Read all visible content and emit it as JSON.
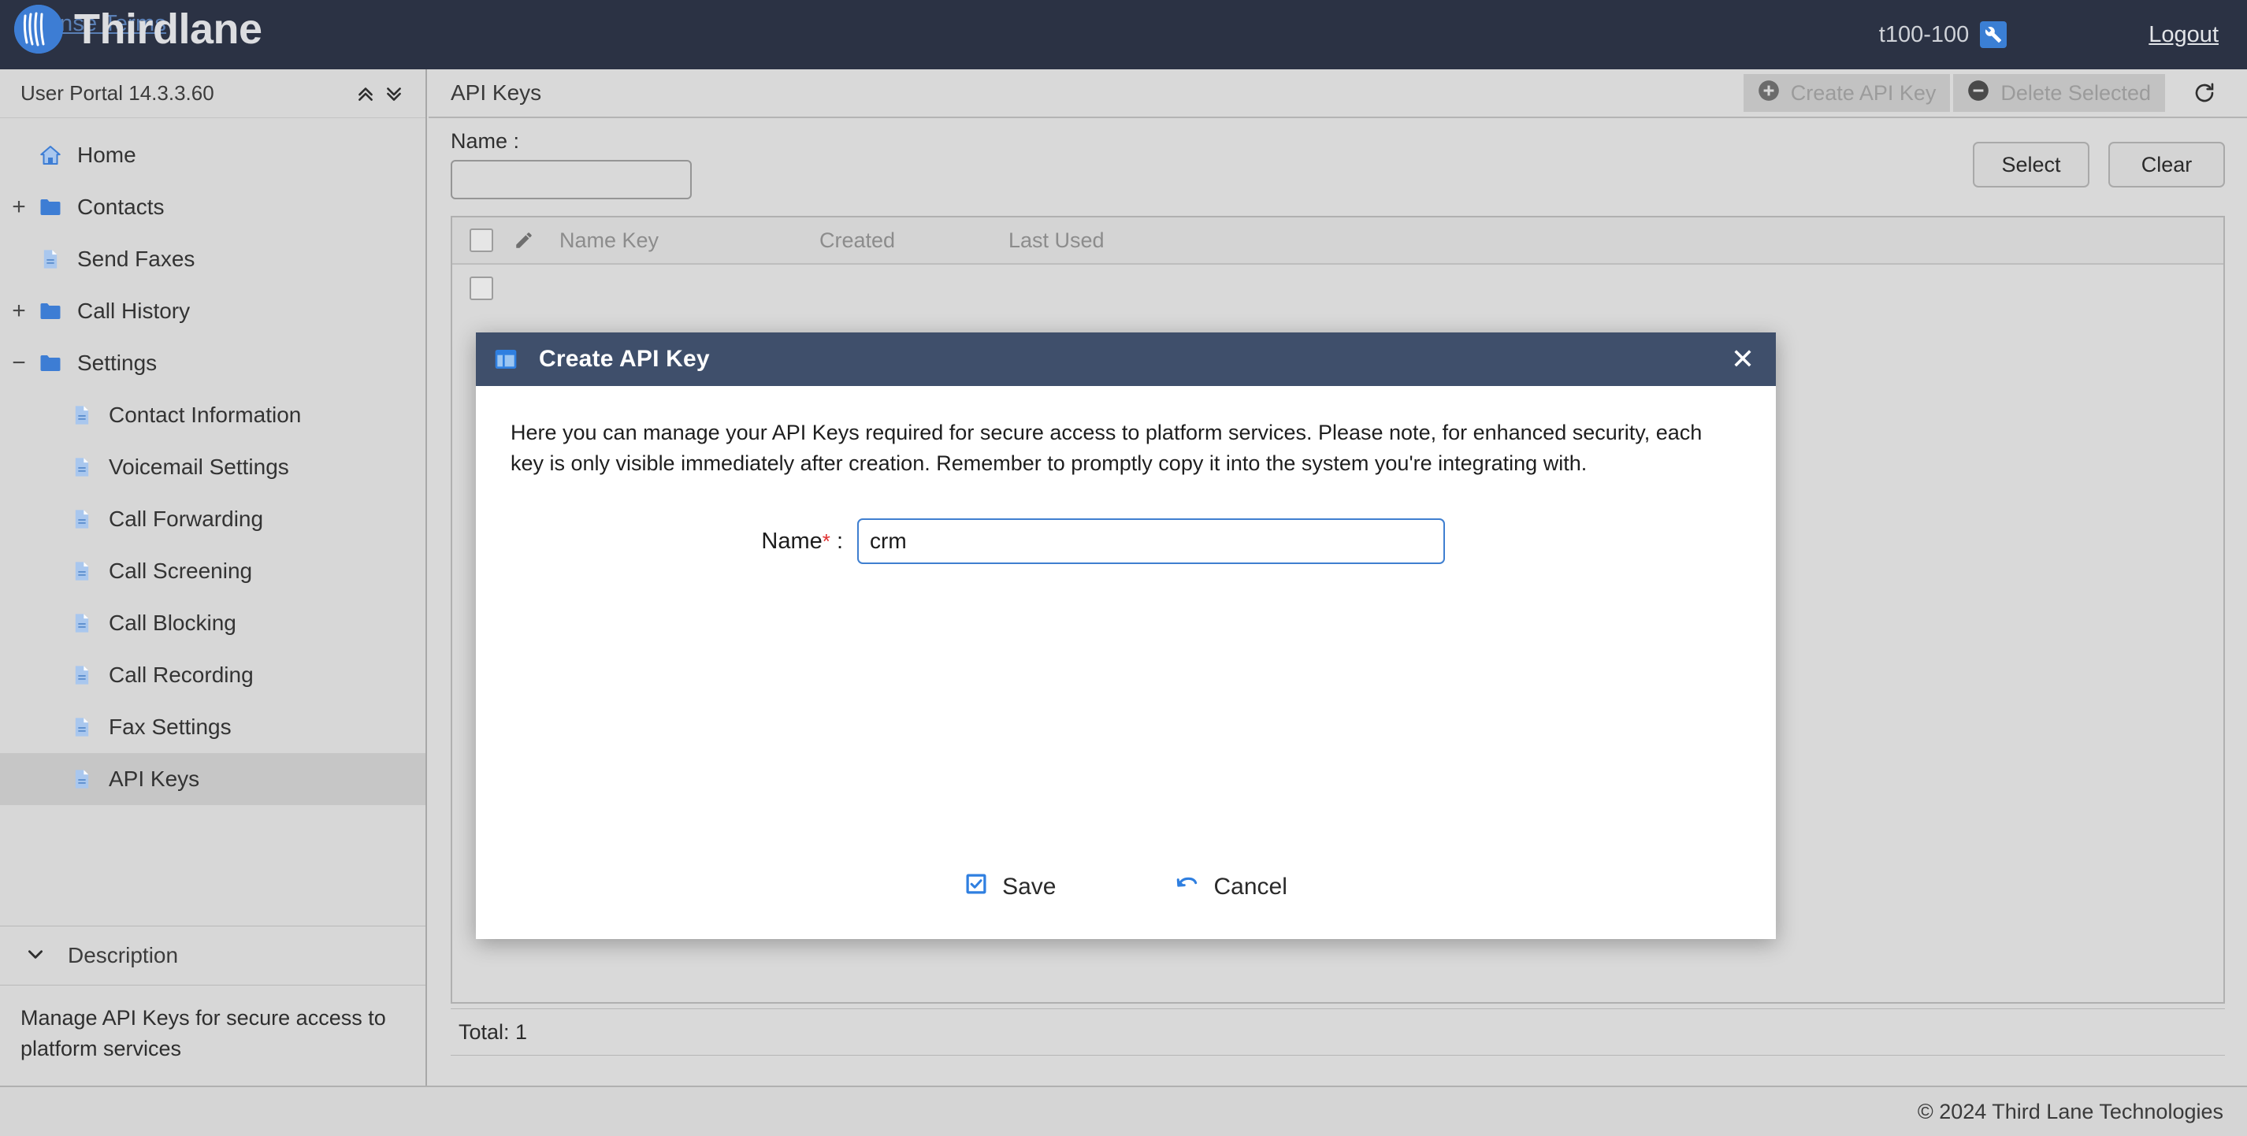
{
  "topbar": {
    "license_link": "License Terms",
    "brand_name": "Thirdlane",
    "account_name": "t100-100",
    "wrench_icon": "wrench-icon",
    "logout_label": "Logout"
  },
  "sidebar": {
    "title": "User Portal 14.3.3.60",
    "collapse_all_icon": "double-chevron-up-icon",
    "expand_all_icon": "double-chevron-down-icon",
    "items": [
      {
        "label": "Home",
        "icon": "home-icon",
        "expander": "",
        "level": 0,
        "selected": false
      },
      {
        "label": "Contacts",
        "icon": "folder-icon",
        "expander": "+",
        "level": 0,
        "selected": false
      },
      {
        "label": "Send Faxes",
        "icon": "document-icon",
        "expander": "",
        "level": 0,
        "selected": false
      },
      {
        "label": "Call History",
        "icon": "folder-icon",
        "expander": "+",
        "level": 0,
        "selected": false
      },
      {
        "label": "Settings",
        "icon": "folder-icon",
        "expander": "−",
        "level": 0,
        "selected": false
      },
      {
        "label": "Contact Information",
        "icon": "document-icon",
        "expander": "",
        "level": 1,
        "selected": false
      },
      {
        "label": "Voicemail Settings",
        "icon": "document-icon",
        "expander": "",
        "level": 1,
        "selected": false
      },
      {
        "label": "Call Forwarding",
        "icon": "document-icon",
        "expander": "",
        "level": 1,
        "selected": false
      },
      {
        "label": "Call Screening",
        "icon": "document-icon",
        "expander": "",
        "level": 1,
        "selected": false
      },
      {
        "label": "Call Blocking",
        "icon": "document-icon",
        "expander": "",
        "level": 1,
        "selected": false
      },
      {
        "label": "Call Recording",
        "icon": "document-icon",
        "expander": "",
        "level": 1,
        "selected": false
      },
      {
        "label": "Fax Settings",
        "icon": "document-icon",
        "expander": "",
        "level": 1,
        "selected": false
      },
      {
        "label": "API Keys",
        "icon": "document-icon",
        "expander": "",
        "level": 1,
        "selected": true
      }
    ],
    "description": {
      "title": "Description",
      "toggle_icon": "chevron-down-icon",
      "text": "Manage API Keys for secure access to platform services"
    }
  },
  "content": {
    "title": "API Keys",
    "toolbar": {
      "create_label": "Create API Key",
      "create_icon": "plus-circle-icon",
      "create_disabled": true,
      "delete_label": "Delete Selected",
      "delete_icon": "minus-circle-icon",
      "delete_disabled": true,
      "refresh_icon": "refresh-icon"
    },
    "filter": {
      "label": "Name :",
      "value": "",
      "placeholder": "",
      "select_label": "Select",
      "clear_label": "Clear"
    },
    "table": {
      "edit_icon": "pencil-icon",
      "columns": [
        "Name Key",
        "Created",
        "Last Used"
      ],
      "rows": [
        {
          "name": "",
          "created": "",
          "last_used": ""
        }
      ]
    },
    "total_text": "Total: 1"
  },
  "modal": {
    "title": "Create API Key",
    "title_icon": "window-icon",
    "close_icon": "close-icon",
    "description": "Here you can manage your API Keys required for secure access to platform services. Please note, for enhanced security, each key is only visible immediately after creation. Remember to promptly copy it into the system you're integrating with.",
    "field_label": "Name",
    "field_required_mark": "*",
    "field_label_suffix": ":",
    "field_value": "crm",
    "field_placeholder": "",
    "save_label": "Save",
    "save_icon": "checkbox-icon",
    "cancel_label": "Cancel",
    "cancel_icon": "undo-arrow-icon"
  },
  "footer": {
    "copyright": "© 2024 Third Lane Technologies"
  },
  "colors": {
    "topbar_bg": "#2b3244",
    "brand_blue": "#3d7dd4",
    "modal_titlebar": "#3f4f6b",
    "accent_blue": "#3f7fd0",
    "required_red": "#e03030",
    "sidebar_bg": "#d7d7d7",
    "selected_row": "#c6c6c6"
  }
}
